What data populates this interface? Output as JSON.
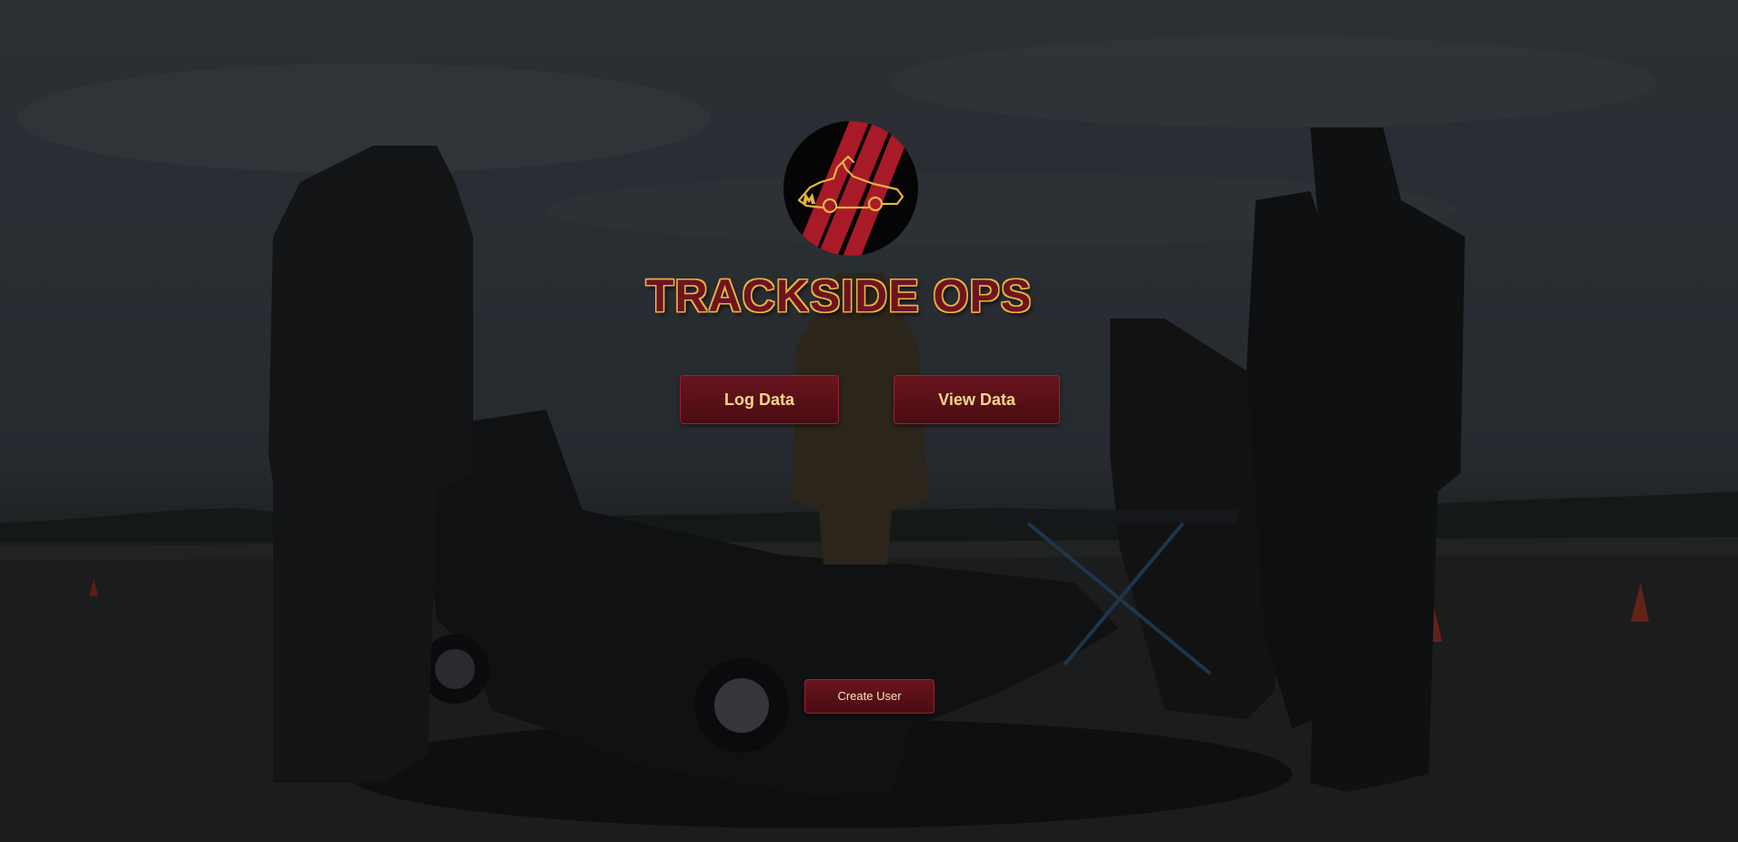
{
  "app": {
    "title": "TRACKSIDE OPS"
  },
  "actions": {
    "log_label": "Log Data",
    "view_label": "View Data",
    "create_user_label": "Create User"
  },
  "logo": {
    "icon": "racecar-logo-icon"
  },
  "colors": {
    "accent_maroon": "#6a141d",
    "accent_gold": "#e8b440",
    "button_text": "#f5d58a"
  }
}
